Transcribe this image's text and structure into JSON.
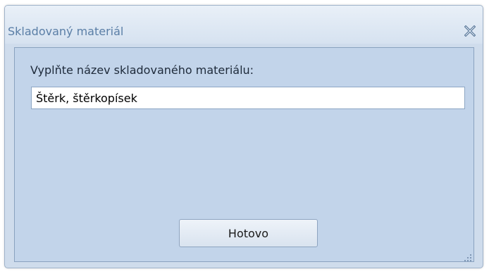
{
  "window": {
    "title": "Skladovaný materiál"
  },
  "form": {
    "prompt_label": "Vyplňte název skladovaného materiálu:",
    "material_value": "Štěrk, štěrkopísek",
    "done_label": "Hotovo"
  },
  "icons": {
    "close": "close-icon",
    "resize": "resize-grip-icon"
  },
  "colors": {
    "title_text": "#5a7ea6",
    "client_background": "#c2d4ea",
    "frame_background": "#cfdcec"
  }
}
